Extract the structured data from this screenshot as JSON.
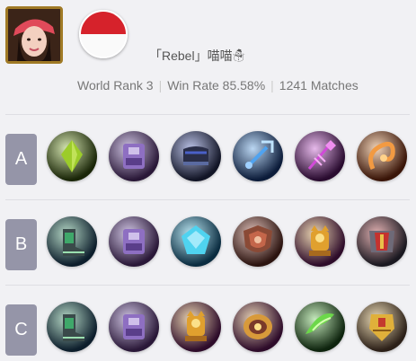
{
  "player": {
    "name": "「Rebel」喵喵☃",
    "world_rank": "World Rank 3",
    "win_rate": "Win Rate 85.58%",
    "matches": "1241 Matches",
    "avatar_icon": "player-avatar",
    "flag_icon": "indonesia-flag-icon"
  },
  "builds": [
    {
      "tier": "A",
      "items": [
        {
          "icon": "green-crystal-icon",
          "bg": "#1a2608",
          "fg": "#9ccc2a"
        },
        {
          "icon": "purple-armor-icon",
          "bg": "#2a1838",
          "fg": "#8e6fc2"
        },
        {
          "icon": "dark-boots-icon",
          "bg": "#121526",
          "fg": "#4a60c8"
        },
        {
          "icon": "blue-trident-icon",
          "bg": "#0c1c3a",
          "fg": "#4fa3f0"
        },
        {
          "icon": "magenta-staff-icon",
          "bg": "#2a0c30",
          "fg": "#d14ad8"
        },
        {
          "icon": "flame-whip-icon",
          "bg": "#3a1508",
          "fg": "#f29a42"
        }
      ]
    },
    {
      "tier": "B",
      "items": [
        {
          "icon": "green-boots-icon",
          "bg": "#0d1e2c",
          "fg": "#3fa86a"
        },
        {
          "icon": "purple-armor-icon",
          "bg": "#2a1838",
          "fg": "#8e6fc2"
        },
        {
          "icon": "blue-gem-icon",
          "bg": "#0a2c40",
          "fg": "#4fd3f0"
        },
        {
          "icon": "red-shield-icon",
          "bg": "#2c1410",
          "fg": "#c4664a"
        },
        {
          "icon": "golden-idol-icon",
          "bg": "#2e0c2a",
          "fg": "#e0a02e"
        },
        {
          "icon": "red-chestplate-icon",
          "bg": "#1a1820",
          "fg": "#c4322e"
        }
      ]
    },
    {
      "tier": "C",
      "items": [
        {
          "icon": "green-boots-icon",
          "bg": "#0d1e2c",
          "fg": "#3fa86a"
        },
        {
          "icon": "purple-armor-icon",
          "bg": "#2a1838",
          "fg": "#8e6fc2"
        },
        {
          "icon": "golden-idol-icon",
          "bg": "#2e0c2a",
          "fg": "#e0a02e"
        },
        {
          "icon": "golden-shield-icon",
          "bg": "#2e0c2a",
          "fg": "#d89a3a"
        },
        {
          "icon": "green-wing-blade-icon",
          "bg": "#0e240e",
          "fg": "#6cd84a"
        },
        {
          "icon": "golden-armor-icon",
          "bg": "#2c2018",
          "fg": "#e0b03a"
        }
      ]
    }
  ]
}
